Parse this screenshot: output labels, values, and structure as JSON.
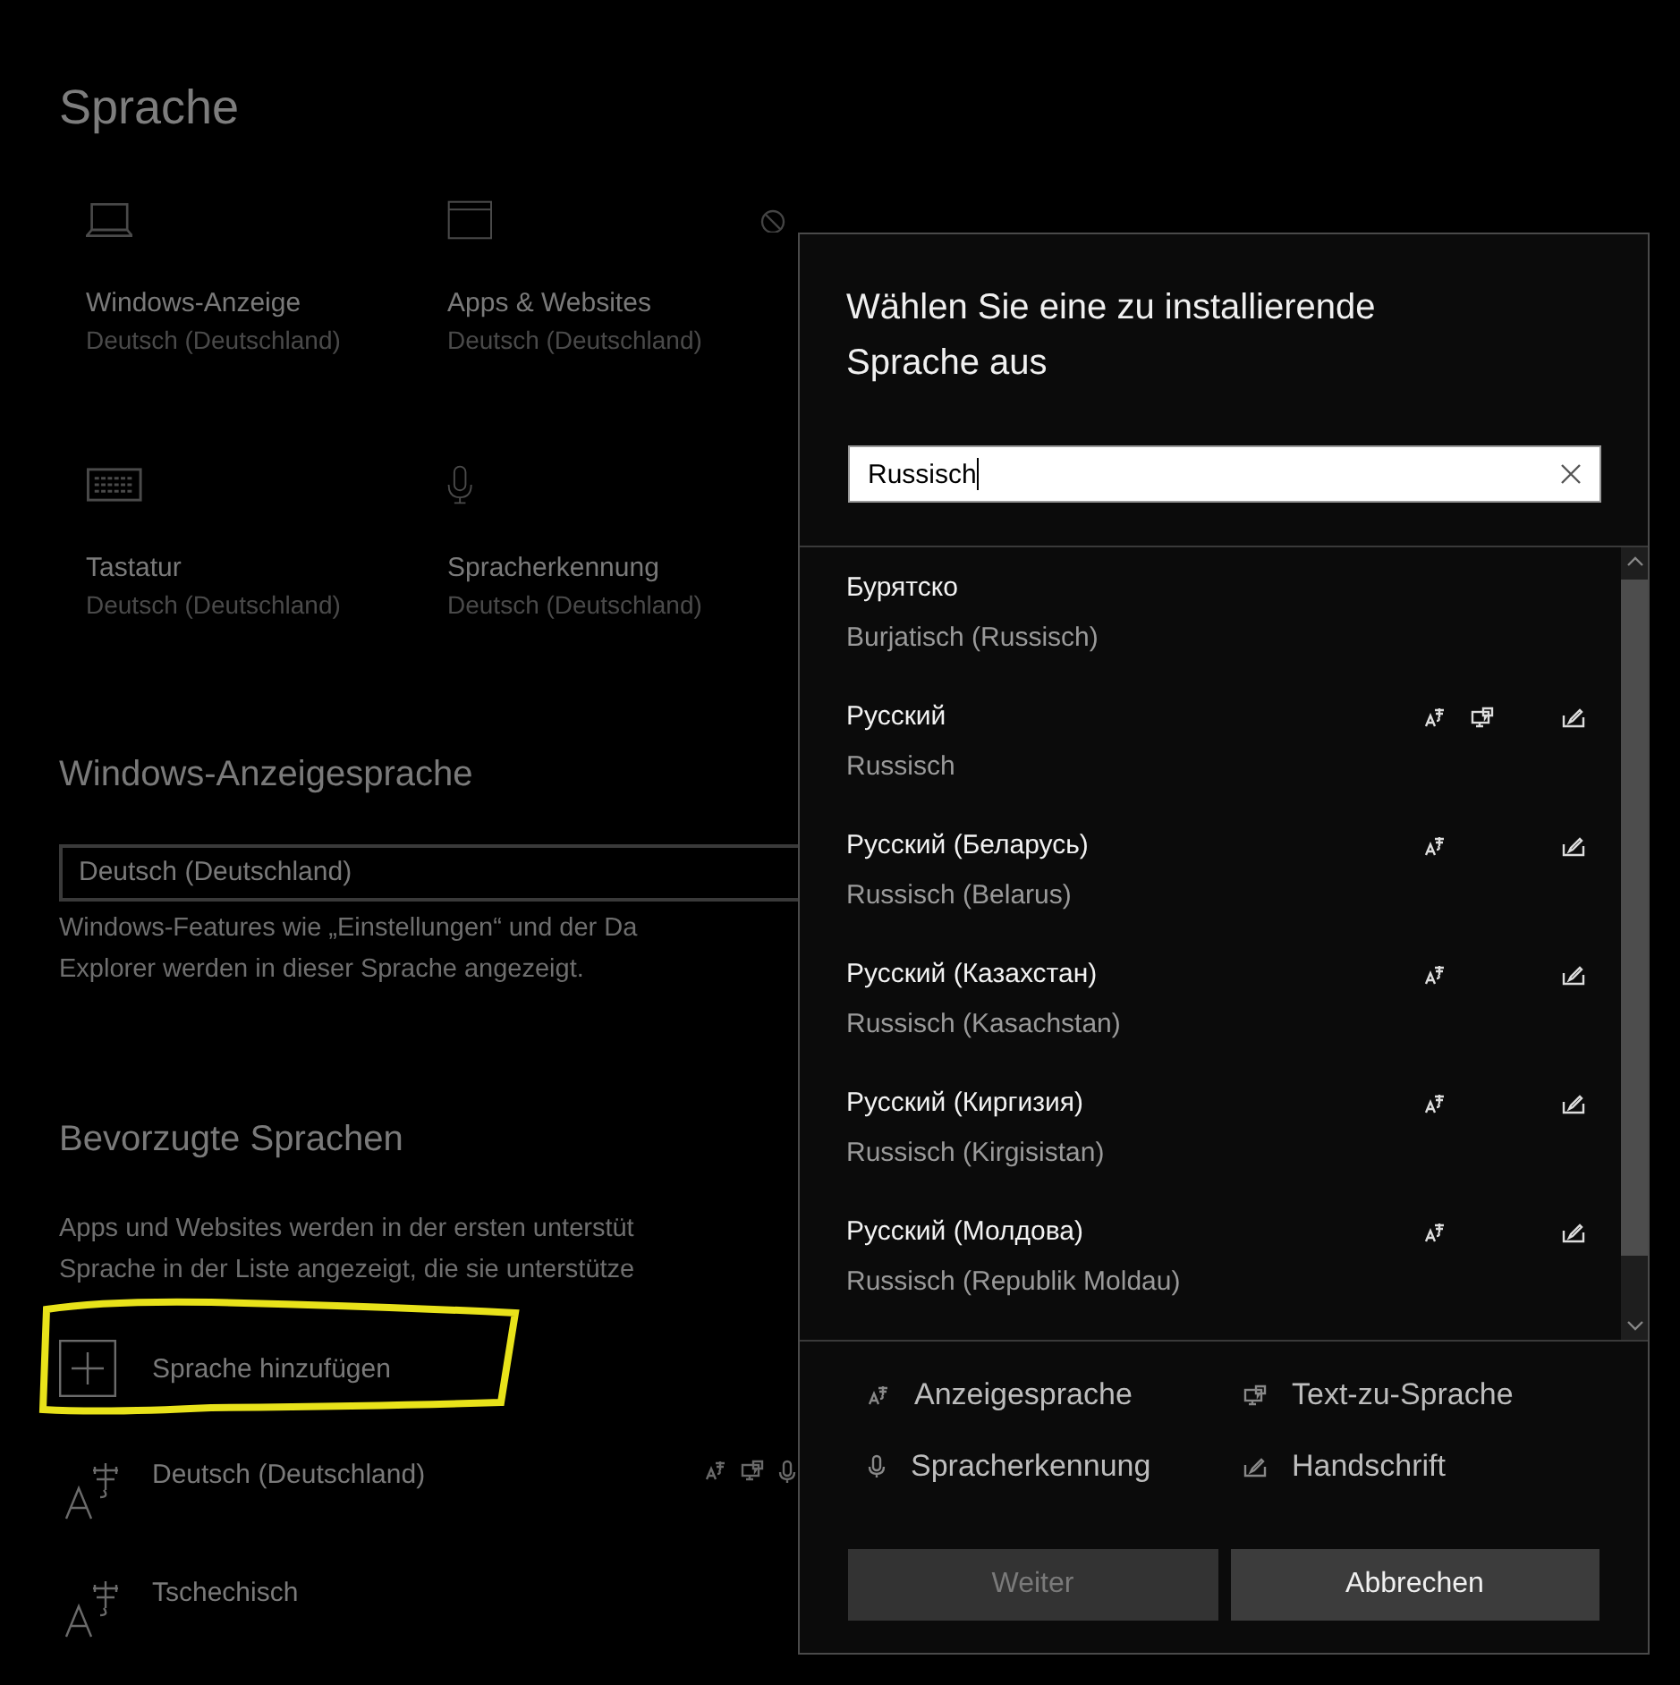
{
  "page": {
    "title": "Sprache"
  },
  "tiles": [
    {
      "kind": "display",
      "label": "Windows-Anzeige",
      "value": "Deutsch (Deutschland)"
    },
    {
      "kind": "apps",
      "label": "Apps & Websites",
      "value": "Deutsch (Deutschland)"
    },
    {
      "kind": "keyboard",
      "label": "Tastatur",
      "value": "Deutsch (Deutschland)"
    },
    {
      "kind": "speech",
      "label": "Spracherkennung",
      "value": "Deutsch (Deutschland)"
    }
  ],
  "display_language": {
    "heading": "Windows-Anzeigesprache",
    "dropdown": "Deutsch (Deutschland)",
    "description": [
      "Windows-Features wie „Einstellungen“ und der Da",
      "Explorer werden in dieser Sprache angezeigt."
    ]
  },
  "preferred": {
    "heading": "Bevorzugte Sprachen",
    "description": [
      "Apps und Websites werden in der ersten unterstüt",
      "Sprache in der Liste angezeigt, die sie unterstütze"
    ],
    "add_button": "Sprache hinzufügen",
    "languages": [
      {
        "name": "Deutsch (Deutschland)",
        "display": true,
        "tts": true,
        "speech": true
      },
      {
        "name": "Tschechisch",
        "display": false,
        "tts": false,
        "speech": false
      }
    ]
  },
  "dialog": {
    "title": "Wählen Sie eine zu installierende Sprache aus",
    "search": {
      "value": "Russisch"
    },
    "results": [
      {
        "name": "Бурятско",
        "subtitle": "Burjatisch (Russisch)",
        "display": false,
        "tts": false,
        "handwriting": false
      },
      {
        "name": "Русский",
        "subtitle": "Russisch",
        "display": true,
        "tts": true,
        "handwriting": true
      },
      {
        "name": "Русский (Беларусь)",
        "subtitle": "Russisch (Belarus)",
        "display": true,
        "tts": false,
        "handwriting": true
      },
      {
        "name": "Русский (Казахстан)",
        "subtitle": "Russisch (Kasachstan)",
        "display": true,
        "tts": false,
        "handwriting": true
      },
      {
        "name": "Русский (Киргизия)",
        "subtitle": "Russisch (Kirgisistan)",
        "display": true,
        "tts": false,
        "handwriting": true
      },
      {
        "name": "Русский (Молдова)",
        "subtitle": "Russisch (Republik Moldau)",
        "display": true,
        "tts": false,
        "handwriting": true
      }
    ],
    "legend": [
      {
        "kind": "display",
        "label": "Anzeigesprache"
      },
      {
        "kind": "tts",
        "label": "Text-zu-Sprache"
      },
      {
        "kind": "speech",
        "label": "Spracherkennung"
      },
      {
        "kind": "handwriting",
        "label": "Handschrift"
      }
    ],
    "buttons": [
      {
        "label": "Weiter",
        "disabled": true
      },
      {
        "label": "Abbrechen",
        "disabled": false
      }
    ]
  }
}
